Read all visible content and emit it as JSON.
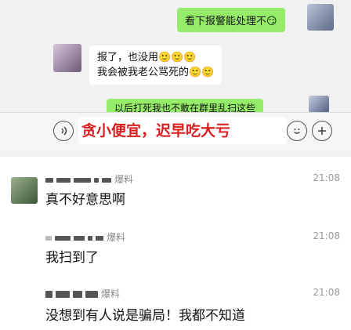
{
  "chat": {
    "out_msg_1": "看下报警能处理不😏",
    "in_msg_1": "报了，也没用🙂🙂🙂",
    "in_msg_2": "我会被我老公骂死的🙂🙂",
    "out_msg_2_partial": "以后打死我也不敢在群里乱扫这些"
  },
  "input_bar": {
    "text": "贪小便宜，迟早吃大亏"
  },
  "group_messages": [
    {
      "name_suffix": "爆料",
      "time": "21:08",
      "text": "真不好意思啊"
    },
    {
      "name_suffix": "爆料",
      "time": "21:08",
      "text": "我扫到了"
    },
    {
      "name_suffix": "爆料",
      "time": "21:08",
      "text": "没想到有人说是骗局！我都不知道"
    }
  ],
  "colors": {
    "accent_green": "#95ec69",
    "alert_red": "#d81e1e"
  }
}
